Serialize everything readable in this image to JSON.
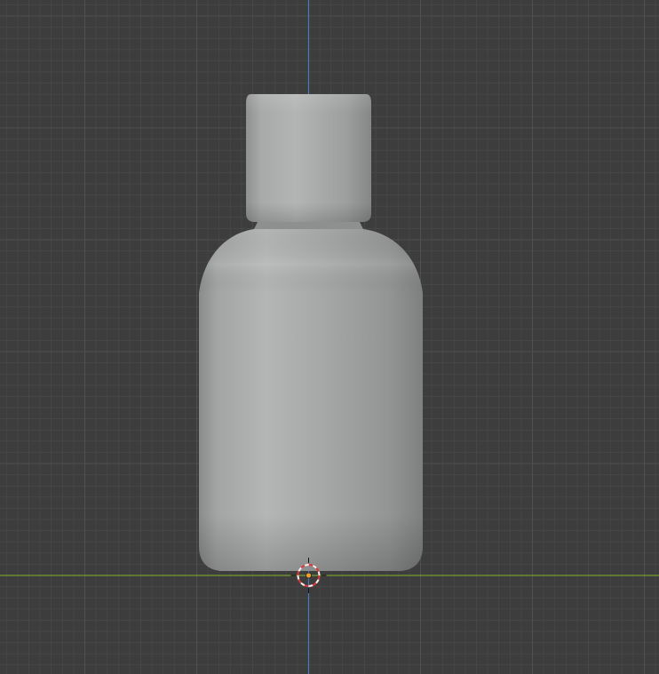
{
  "viewport": {
    "view": "front-orthographic",
    "background_color": "#3d3d3d",
    "grid_minor_color": "#474747",
    "grid_major_color": "#505050",
    "x_axis_color": "#7a9a2e",
    "z_axis_color": "#4a7ab8"
  },
  "scene": {
    "object": {
      "kind": "bottle",
      "shading": "solid",
      "body_color": "#9c9e9d",
      "highlight_color": "#b2b4b3",
      "shadow_color": "#7d7f7e"
    },
    "cursor": {
      "icon": "3d-cursor-icon",
      "ring_color_a": "#d73a3a",
      "ring_color_b": "#f2f2f2"
    },
    "origin": {
      "icon": "origin-dot-icon",
      "color": "#f0a030"
    }
  }
}
